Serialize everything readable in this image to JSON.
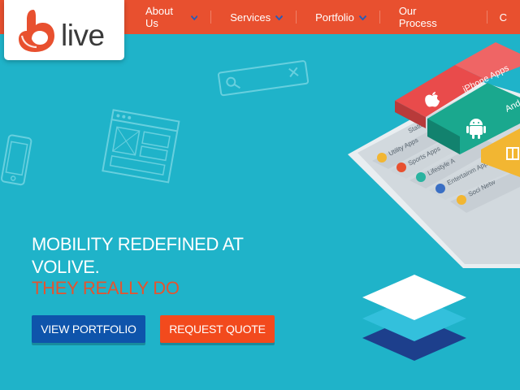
{
  "brand": {
    "logo_text": "live",
    "colors": {
      "header": "#e8502f",
      "background": "#1fb3c9",
      "primary_button": "#0e54ab",
      "accent_button": "#f24a1d",
      "accent_text": "#e4542f"
    }
  },
  "nav": {
    "items": [
      {
        "label": "About Us",
        "has_dropdown": true
      },
      {
        "label": "Services",
        "has_dropdown": true
      },
      {
        "label": "Portfolio",
        "has_dropdown": true
      },
      {
        "label": "Our Process",
        "has_dropdown": false
      },
      {
        "label": "C",
        "has_dropdown": false
      }
    ]
  },
  "hero": {
    "title": "MOBILITY REDEFINED AT VOLIVE.",
    "subtitle": "THEY REALLY DO",
    "buttons": {
      "portfolio": "VIEW PORTFOLIO",
      "quote": "REQUEST QUOTE"
    }
  },
  "device": {
    "tiles": {
      "iphone": "iPhone Apps",
      "android": "And"
    },
    "list": [
      "Utility Apps",
      "Sports Apps",
      "Lifestyle A",
      "Entertainm Apps",
      "Soci Netw"
    ],
    "top_fragment": "Statis"
  },
  "icons": [
    "apple-icon",
    "android-icon",
    "search-icon",
    "close-icon",
    "chevron-down-icon",
    "phone-outline-icon",
    "wireframe-window-icon",
    "layers-stack-icon"
  ]
}
